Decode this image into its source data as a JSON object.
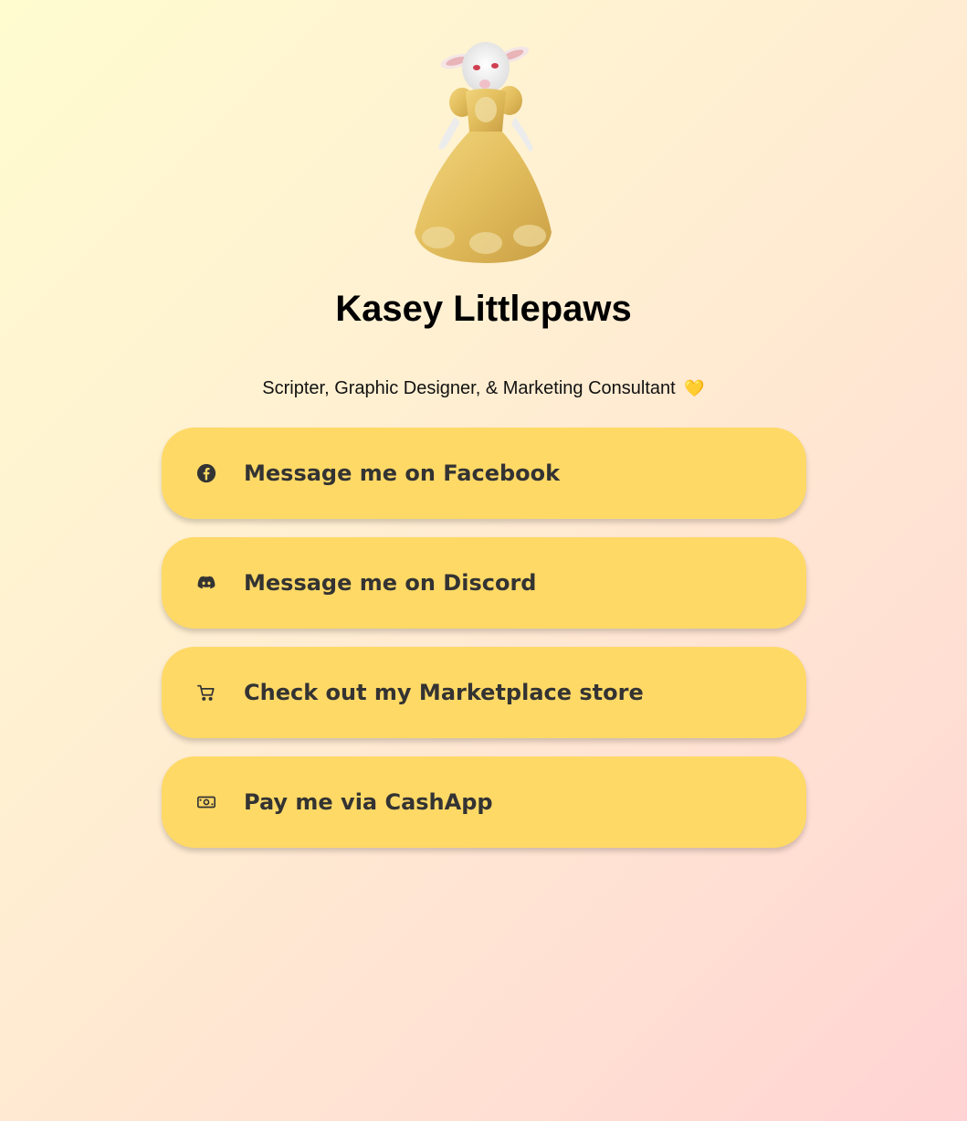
{
  "profile": {
    "name": "Kasey Littlepaws",
    "bio": "Scripter, Graphic Designer, & Marketing Consultant",
    "bio_emoji": "💛"
  },
  "links": [
    {
      "label": "Message me on Facebook",
      "icon": "facebook-icon"
    },
    {
      "label": "Message me on Discord",
      "icon": "discord-icon"
    },
    {
      "label": "Check out my Marketplace store",
      "icon": "shopping-cart-icon"
    },
    {
      "label": "Pay me via CashApp",
      "icon": "money-bill-icon"
    }
  ],
  "colors": {
    "button_bg": "#ffd966",
    "button_text": "#333333",
    "bg_start": "#fffcd0",
    "bg_end": "#ffd3d3"
  }
}
